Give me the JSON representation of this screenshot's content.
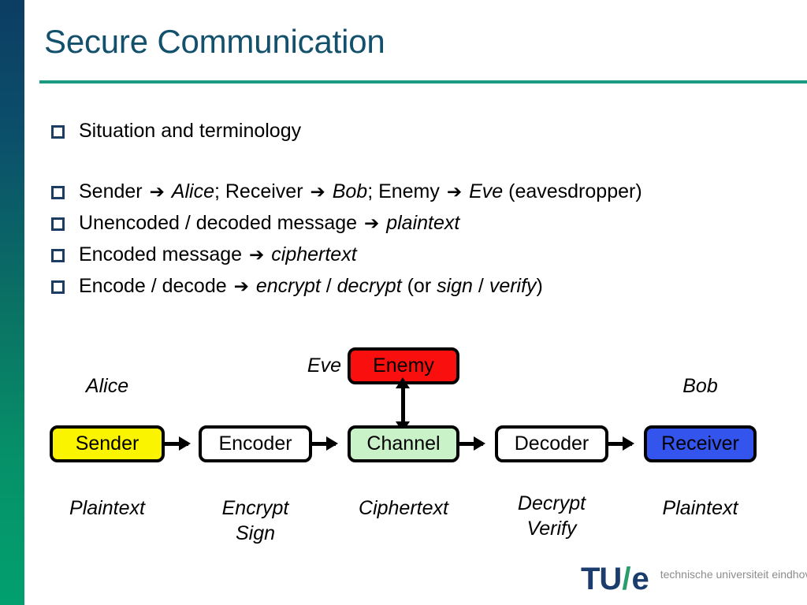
{
  "slide": {
    "title": "Secure Communication",
    "accent_color": "#1a9a80",
    "title_color": "#12506c",
    "sidebar_gradient_top": "#0c3d63",
    "sidebar_gradient_bottom": "#02a06e"
  },
  "bullets": [
    {
      "id": "situation",
      "segments": [
        {
          "text": "Situation and terminology",
          "style": "normal"
        }
      ]
    },
    {
      "id": "names",
      "segments": [
        {
          "text": "Sender ",
          "style": "normal"
        },
        {
          "text": "➔",
          "style": "arrow"
        },
        {
          "text": " ",
          "style": "normal"
        },
        {
          "text": "Alice",
          "style": "italic"
        },
        {
          "text": "; Receiver ",
          "style": "normal"
        },
        {
          "text": "➔",
          "style": "arrow"
        },
        {
          "text": " ",
          "style": "normal"
        },
        {
          "text": "Bob",
          "style": "italic"
        },
        {
          "text": "; Enemy ",
          "style": "normal"
        },
        {
          "text": "➔",
          "style": "arrow"
        },
        {
          "text": " ",
          "style": "normal"
        },
        {
          "text": "Eve",
          "style": "italic"
        },
        {
          "text": " (eavesdropper)",
          "style": "normal"
        }
      ]
    },
    {
      "id": "plaintext",
      "segments": [
        {
          "text": "Unencoded / decoded message ",
          "style": "normal"
        },
        {
          "text": "➔",
          "style": "arrow"
        },
        {
          "text": " ",
          "style": "normal"
        },
        {
          "text": "plaintext",
          "style": "italic"
        }
      ]
    },
    {
      "id": "ciphertext",
      "segments": [
        {
          "text": "Encoded message ",
          "style": "normal"
        },
        {
          "text": "➔",
          "style": "arrow"
        },
        {
          "text": " ",
          "style": "normal"
        },
        {
          "text": "ciphertext",
          "style": "italic"
        }
      ]
    },
    {
      "id": "encrypt-decrypt",
      "segments": [
        {
          "text": "Encode / decode ",
          "style": "normal"
        },
        {
          "text": "➔",
          "style": "arrow"
        },
        {
          "text": " ",
          "style": "normal"
        },
        {
          "text": "encrypt",
          "style": "italic"
        },
        {
          "text": " / ",
          "style": "normal"
        },
        {
          "text": "decrypt",
          "style": "italic"
        },
        {
          "text": " (or ",
          "style": "normal"
        },
        {
          "text": "sign",
          "style": "italic"
        },
        {
          "text": " / ",
          "style": "normal"
        },
        {
          "text": "verify",
          "style": "italic"
        },
        {
          "text": ")",
          "style": "normal"
        }
      ]
    }
  ],
  "diagram": {
    "nodes": {
      "sender": {
        "label": "Sender",
        "fill": "#fbf400"
      },
      "encoder": {
        "label": "Encoder",
        "fill": "#ffffff"
      },
      "channel": {
        "label": "Channel",
        "fill": "#caf2c9"
      },
      "decoder": {
        "label": "Decoder",
        "fill": "#ffffff"
      },
      "receiver": {
        "label": "Receiver",
        "fill": "#3355ee"
      },
      "enemy": {
        "label": "Enemy",
        "fill": "#fa0f0f"
      }
    },
    "actor_labels": {
      "alice": "Alice",
      "bob": "Bob",
      "eve": "Eve"
    },
    "stage_labels": {
      "sender": "Plaintext",
      "encoder_line1": "Encrypt",
      "encoder_line2": "Sign",
      "channel": "Ciphertext",
      "decoder_line1": "Decrypt",
      "decoder_line2": "Verify",
      "receiver": "Plaintext"
    }
  },
  "logo": {
    "tu": "TU",
    "slash": "/",
    "e": "e",
    "tagline": "technische universiteit eindhoven"
  }
}
